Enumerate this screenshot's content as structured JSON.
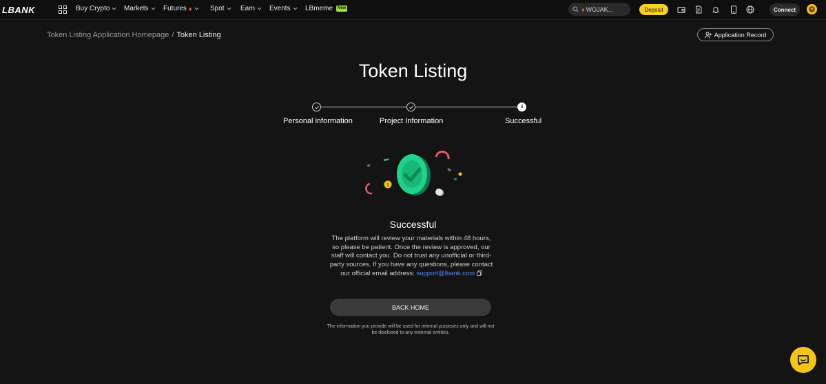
{
  "nav": {
    "logo": "LBANK",
    "items": [
      {
        "label": "Buy Crypto"
      },
      {
        "label": "Markets"
      },
      {
        "label": "Futures"
      },
      {
        "label": "Spot"
      },
      {
        "label": "Earn"
      },
      {
        "label": "Events"
      },
      {
        "label": "LBmeme",
        "badge": "New"
      }
    ],
    "search_value": "WOJAK...",
    "deposit_label": "Deposit",
    "connect_label": "Connect",
    "icons": [
      "apps-icon",
      "wallet-icon",
      "orders-icon",
      "bell-icon",
      "download-icon",
      "globe-icon"
    ]
  },
  "breadcrumb": {
    "parent": "Token Listing Application Homepage",
    "separator": "/",
    "current": "Token Listing"
  },
  "application_record_label": "Application Record",
  "page_title": "Token Listing",
  "stepper": {
    "steps": [
      {
        "label": "Personal information",
        "status": "done"
      },
      {
        "label": "Project Information",
        "status": "done"
      },
      {
        "label": "Successful",
        "status": "current",
        "number": "3"
      }
    ]
  },
  "result": {
    "title": "Successful",
    "description": "The platform will review your materials within 48 hours, so please be patient. Once the review is approved, our staff will contact you. Do not trust any unofficial or third-party sources. If you have any questions, please contact our official email address:",
    "email": "support@lbank.com",
    "back_home_label": "BACK HOME",
    "disclaimer": "The information you provide will be used for internal purposes only and will not be disclosed to any external entities."
  },
  "colors": {
    "accent_yellow": "#f5d120",
    "success_green": "#1fd18b",
    "link_blue": "#4d8cff",
    "background": "#141414"
  }
}
